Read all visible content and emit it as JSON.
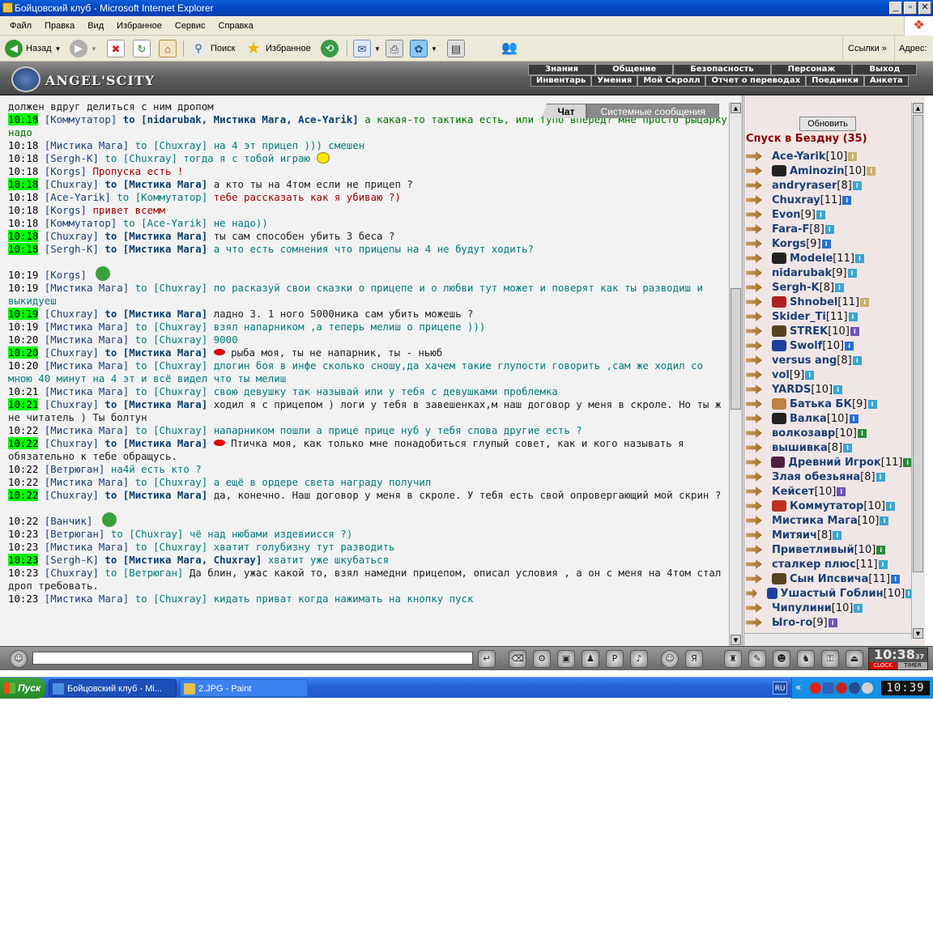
{
  "window": {
    "title": "Бойцовский клуб - Microsoft Internet Explorer"
  },
  "menu": [
    "Файл",
    "Правка",
    "Вид",
    "Избранное",
    "Сервис",
    "Справка"
  ],
  "toolbar": {
    "back": "Назад",
    "search": "Поиск",
    "favorites": "Избранное",
    "links": "Ссылки",
    "address": "Адрес:"
  },
  "game": {
    "logo": "ANGEL'SCITY",
    "nav_top": [
      "Знания",
      "Общение",
      "Безопасность",
      "Персонаж",
      "Выход"
    ],
    "nav_bottom": [
      "Инвентарь",
      "Умения",
      "Мой Скролл",
      "Отчет о переводах",
      "Поединки",
      "Анкета"
    ]
  },
  "chat": {
    "tabs": {
      "chat": "Чат",
      "system": "Системные сообщения"
    },
    "partial_top": "должен вдруг делиться с ним дропом",
    "messages": [
      {
        "t": "10:18",
        "hl": true,
        "n": "[Коммутатор]",
        "to": "to [nidarubak, Мистика Мага, Ace-Yarik]",
        "tob": true,
        "x": "а какая-то тактика есть, или тупо вперед? мне просто рыцарку надо",
        "c": "green"
      },
      {
        "t": "10:18",
        "hl": false,
        "n": "[Мистика Мага]",
        "to": "to [Chuxray]",
        "tob": false,
        "x": "на 4 эт прицеп ))) смешен",
        "c": "teal"
      },
      {
        "t": "10:18",
        "hl": false,
        "n": "[Sergh-K]",
        "to": "to [Chuxray]",
        "tob": false,
        "x": "тогда я с тобой играю",
        "c": "teal",
        "sm": "smile"
      },
      {
        "t": "10:18",
        "hl": false,
        "n": "[Korgs]",
        "to": "",
        "tob": false,
        "x": "Пропуска есть !",
        "c": "red"
      },
      {
        "t": "10:18",
        "hl": true,
        "n": "[Chuxray]",
        "to": "to [Мистика Мага]",
        "tob": true,
        "x": "а кто ты на 4том если не прицеп ?",
        "c": "dark"
      },
      {
        "t": "10:18",
        "hl": false,
        "n": "[Ace-Yarik]",
        "to": "to [Коммутатор]",
        "tob": false,
        "x": "тебе рассказать как я убиваю ?)",
        "c": "red"
      },
      {
        "t": "10:18",
        "hl": false,
        "n": "[Korgs]",
        "to": "",
        "tob": false,
        "x": "привет всемм",
        "c": "red"
      },
      {
        "t": "10:18",
        "hl": false,
        "n": "[Коммутатор]",
        "to": "to [Ace-Yarik]",
        "tob": false,
        "x": "не надо))",
        "c": "teal"
      },
      {
        "t": "10:18",
        "hl": true,
        "n": "[Chuxray]",
        "to": "to [Мистика Мага]",
        "tob": true,
        "x": "ты сам способен убить 3 беса ?",
        "c": "dark"
      },
      {
        "t": "10:18",
        "hl": true,
        "n": "[Sergh-K]",
        "to": "to [Мистика Мага]",
        "tob": true,
        "x": "а что есть сомнения что прицепы на 4 не будут ходить?",
        "c": "teal"
      },
      {
        "t": "10:19",
        "hl": false,
        "n": "[Korgs]",
        "to": "",
        "tob": false,
        "x": "",
        "c": "dark",
        "gap": true
      },
      {
        "t": "10:19",
        "hl": false,
        "n": "[Мистика Мага]",
        "to": "to [Chuxray]",
        "tob": false,
        "x": "по расказуй свои сказки о прицепе и о любви тут может и поверят как ты разводиш и выкидуеш",
        "c": "teal"
      },
      {
        "t": "10:19",
        "hl": true,
        "n": "[Chuxray]",
        "to": "to [Мистика Мага]",
        "tob": true,
        "x": "ладно 3. 1 ного 5000ника сам убить можешь ?",
        "c": "dark"
      },
      {
        "t": "10:19",
        "hl": false,
        "n": "[Мистика Мага]",
        "to": "to [Chuxray]",
        "tob": false,
        "x": "взял напарником ,а теперь мелиш о прицепе )))",
        "c": "teal"
      },
      {
        "t": "10:20",
        "hl": false,
        "n": "[Мистика Мага]",
        "to": "to [Chuxray]",
        "tob": false,
        "x": "9000",
        "c": "teal"
      },
      {
        "t": "10:20",
        "hl": true,
        "n": "[Chuxray]",
        "to": "to [Мистика Мага]",
        "tob": true,
        "x": "рыба моя, ты не напарник, ты - ньюб",
        "c": "dark",
        "sm": "lips"
      },
      {
        "t": "10:20",
        "hl": false,
        "n": "[Мистика Мага]",
        "to": "to [Chuxray]",
        "tob": false,
        "x": "длогин боя в инфе сколько сношу,да хачем такие глупости говорить ,сам же ходил со мною 40 минут на 4 эт и всё видел что ты мелиш",
        "c": "teal"
      },
      {
        "t": "10:21",
        "hl": false,
        "n": "[Мистика Мага]",
        "to": "to [Chuxray]",
        "tob": false,
        "x": "свою девушку так называй или у тебя с девушками проблемка",
        "c": "teal"
      },
      {
        "t": "10:21",
        "hl": true,
        "n": "[Chuxray]",
        "to": "to [Мистика Мага]",
        "tob": true,
        "x": "ходил я с прицепом ) логи у тебя в завешенках,м наш договор у меня в скроле. Но ты ж не читатель ) Ты болтун",
        "c": "dark"
      },
      {
        "t": "10:22",
        "hl": false,
        "n": "[Мистика Мага]",
        "to": "to [Chuxray]",
        "tob": false,
        "x": "напарником пошли а прице прице нуб у тебя слова другие есть ?",
        "c": "teal"
      },
      {
        "t": "10:22",
        "hl": true,
        "n": "[Chuxray]",
        "to": "to [Мистика Мага]",
        "tob": true,
        "x": "Птичка моя, как только мне понадобиться глупый совет, как и кого называть я обязательно к тебе обращусь.",
        "c": "dark",
        "sm": "lips"
      },
      {
        "t": "10:22",
        "hl": false,
        "n": "[Ветрюган]",
        "to": "",
        "tob": false,
        "x": "на4й есть кто ?",
        "c": "teal"
      },
      {
        "t": "10:22",
        "hl": false,
        "n": "[Мистика Мага]",
        "to": "to [Chuxray]",
        "tob": false,
        "x": "а ещё в ордере света награду получил",
        "c": "teal"
      },
      {
        "t": "10:22",
        "hl": true,
        "n": "[Chuxray]",
        "to": "to [Мистика Мага]",
        "tob": true,
        "x": "да, конечно. Наш договор у меня в скроле. У тебя есть свой опровергающий мой скрин ?",
        "c": "dark"
      },
      {
        "t": "10:22",
        "hl": false,
        "n": "[Ванчик]",
        "to": "",
        "tob": false,
        "x": "",
        "c": "dark",
        "gap": true
      },
      {
        "t": "10:23",
        "hl": false,
        "n": "[Ветрюган]",
        "to": "to [Chuxray]",
        "tob": false,
        "x": "чё над нюбами издевиисся ?)",
        "c": "teal"
      },
      {
        "t": "10:23",
        "hl": false,
        "n": "[Мистика Мага]",
        "to": "to [Chuxray]",
        "tob": false,
        "x": "хватит голубизну тут разводить",
        "c": "teal"
      },
      {
        "t": "10:23",
        "hl": true,
        "n": "[Sergh-K]",
        "to": "to [Мистика Мага, Chuxray]",
        "tob": true,
        "x": "хватит уже шкубаться",
        "c": "teal"
      },
      {
        "t": "10:23",
        "hl": false,
        "n": "[Chuxray]",
        "to": "to [Ветрюган]",
        "tob": false,
        "x": "Да блин, ужас какой то, взял намедни прицепом, описал условия , а он с меня на 4том стал дроп требовать.",
        "c": "dark"
      },
      {
        "t": "10:23",
        "hl": false,
        "n": "[Мистика Мага]",
        "to": "to [Chuxray]",
        "tob": false,
        "x": "кидать приват когда нажимать на кнопку пуск",
        "c": "teal"
      }
    ]
  },
  "users": {
    "refresh": "Обновить",
    "room": "Спуск в Бездну (35)",
    "list": [
      {
        "n": "Ace-Yarik",
        "l": "[10]",
        "ic": "#c8b070",
        "cl": ""
      },
      {
        "n": "Aminozin",
        "l": "[10]",
        "ic": "#c8b070",
        "cl": "#222"
      },
      {
        "n": "andryraser",
        "l": "[8]",
        "ic": "#3aa6d0",
        "cl": ""
      },
      {
        "n": "Chuxray",
        "l": "[11]",
        "ic": "#2a6fd0",
        "cl": ""
      },
      {
        "n": "Evon",
        "l": "[9]",
        "ic": "#3aa6d0",
        "cl": ""
      },
      {
        "n": "Fara-F",
        "l": "[8]",
        "ic": "#3aa6d0",
        "cl": ""
      },
      {
        "n": "Korgs",
        "l": "[9]",
        "ic": "#2a6fd0",
        "cl": ""
      },
      {
        "n": "Modele",
        "l": "[11]",
        "ic": "#3aa6d0",
        "cl": "#222"
      },
      {
        "n": "nidarubak",
        "l": "[9]",
        "ic": "#3aa6d0",
        "cl": ""
      },
      {
        "n": "Sergh-K",
        "l": "[8]",
        "ic": "#3aa6d0",
        "cl": ""
      },
      {
        "n": "Shnobel",
        "l": "[11]",
        "ic": "#c8b070",
        "cl": "#b02020"
      },
      {
        "n": "Skider_Ti",
        "l": "[11]",
        "ic": "#3aa6d0",
        "cl": ""
      },
      {
        "n": "STREK",
        "l": "[10]",
        "ic": "#7050c0",
        "cl": "#554422"
      },
      {
        "n": "Swolf",
        "l": "[10]",
        "ic": "#2a6fd0",
        "cl": "#2040a0"
      },
      {
        "n": "versus ang",
        "l": "[8]",
        "ic": "#3aa6d0",
        "cl": ""
      },
      {
        "n": "vol",
        "l": "[9]",
        "ic": "#3aa6d0",
        "cl": ""
      },
      {
        "n": "YARDS",
        "l": "[10]",
        "ic": "#3aa6d0",
        "cl": ""
      },
      {
        "n": "Батька БК",
        "l": "[9]",
        "ic": "#3aa6d0",
        "cl": "#c08040"
      },
      {
        "n": "Валка",
        "l": "[10]",
        "ic": "#2a6fd0",
        "cl": "#222"
      },
      {
        "n": "волкозавр",
        "l": "[10]",
        "ic": "#2a8a3a",
        "cl": ""
      },
      {
        "n": "вышивка",
        "l": "[8]",
        "ic": "#3aa6d0",
        "cl": ""
      },
      {
        "n": "Древний Игрок",
        "l": "[11]",
        "ic": "#2a8a3a",
        "cl": "#502040"
      },
      {
        "n": "Злая обезьяна",
        "l": "[8]",
        "ic": "#3aa6d0",
        "cl": ""
      },
      {
        "n": "Кейсет",
        "l": "[10]",
        "ic": "#7050c0",
        "cl": ""
      },
      {
        "n": "Коммутатор",
        "l": "[10]",
        "ic": "#3aa6d0",
        "cl": "#c03020"
      },
      {
        "n": "Мистика Мага",
        "l": "[10]",
        "ic": "#3aa6d0",
        "cl": ""
      },
      {
        "n": "Митяич",
        "l": "[8]",
        "ic": "#3aa6d0",
        "cl": ""
      },
      {
        "n": "Приветливый",
        "l": "[10]",
        "ic": "#2a8a3a",
        "cl": ""
      },
      {
        "n": "сталкер плюс",
        "l": "[11]",
        "ic": "#3aa6d0",
        "cl": ""
      },
      {
        "n": "Сын Ипсвича",
        "l": "[11]",
        "ic": "#2a6fd0",
        "cl": "#554422"
      },
      {
        "n": "Ушастый Гоблин",
        "l": "[10]",
        "ic": "#3aa6d0",
        "cl": "#2040a0"
      },
      {
        "n": "Чипулини",
        "l": "[10]",
        "ic": "#3aa6d0",
        "cl": ""
      },
      {
        "n": "Ыго-го",
        "l": "[9]",
        "ic": "#7050c0",
        "cl": ""
      }
    ]
  },
  "clock": {
    "time": "10:38",
    "sec": "37",
    "clock_label": "CLOCK",
    "timer_label": "TIMER"
  },
  "taskbar": {
    "start": "Пуск",
    "tasks": [
      "Бойцовский клуб - Mi...",
      "2.JPG - Paint"
    ],
    "lang": "RU",
    "time": "10:39"
  }
}
